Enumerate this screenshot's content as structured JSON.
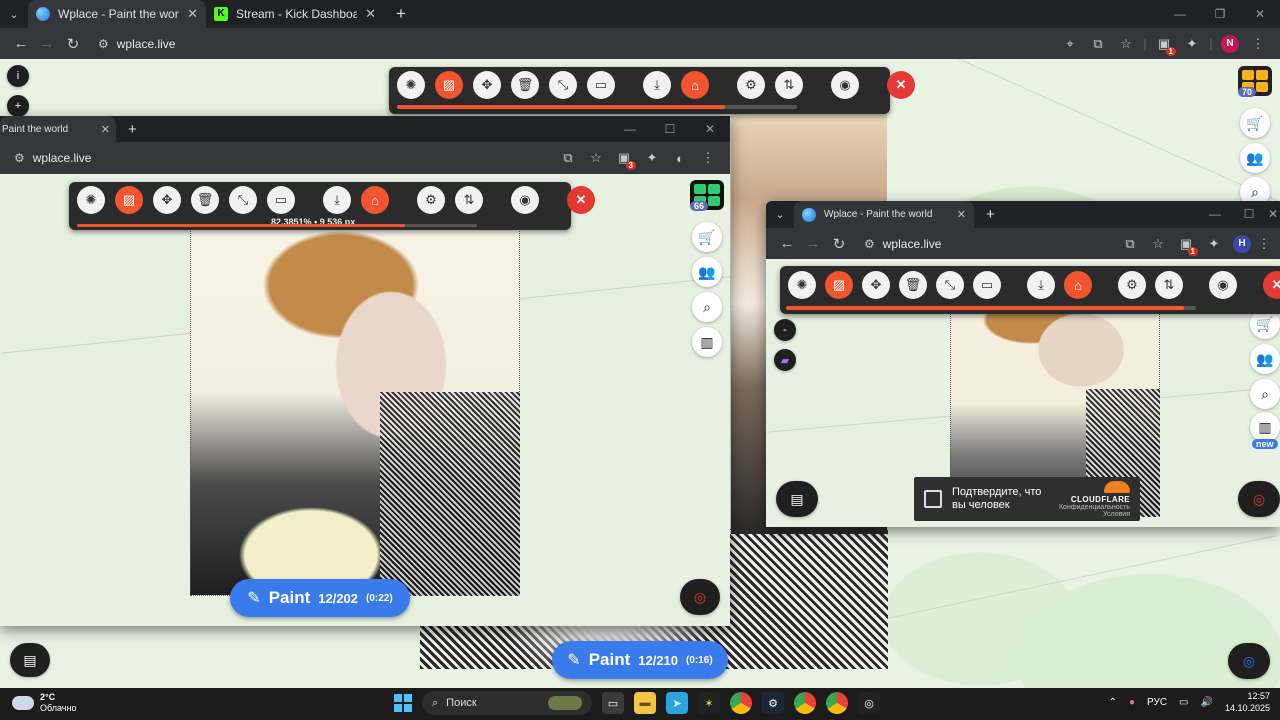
{
  "browser": {
    "tabs": [
      {
        "title": "Wplace - Paint the world",
        "active": true
      },
      {
        "title": "Stream - Kick Dashboard",
        "active": false
      }
    ],
    "url": "wplace.live",
    "profile_initial": "N",
    "ext_badge": "1"
  },
  "map_controls": {
    "info_label": "i",
    "zoom_in_label": "+",
    "level_badge": "70"
  },
  "bot_panel_main": {
    "progress_fraction": 0.82
  },
  "window_left": {
    "tab_title": "Paint the world",
    "url": "wplace.live",
    "ext_badge": "3",
    "bot_panel": {
      "stats_percent": "82.3851%",
      "stats_sep": "•",
      "stats_count": "9 536 px",
      "progress_fraction": 0.82
    },
    "level_badge": "66",
    "paint_button": {
      "label": "Paint",
      "count": "12/202",
      "timer": "(0:22)"
    }
  },
  "window_right": {
    "tab_title": "Wplace - Paint the world",
    "url": "wplace.live",
    "ext_badge": "1",
    "profile_initial": "H",
    "new_badge": "new",
    "zoom_out_label": "-",
    "captcha": {
      "text": "Подтвердите, что вы человек",
      "brand": "CLOUDFLARE",
      "links": "Конфиденциальность",
      "terms": "Условия"
    },
    "bot_panel": {
      "progress_fraction": 0.97
    }
  },
  "paint_button_bottom": {
    "label": "Paint",
    "count": "12/210",
    "timer": "(0:16)"
  },
  "taskbar": {
    "weather_temp": "2°C",
    "weather_desc": "Облачно",
    "search_placeholder": "Поиск",
    "lang": "РУС",
    "time": "12:57",
    "date": "14.10.2025"
  },
  "colors": {
    "accent": "#f0552f",
    "paint_blue": "#3a7bec",
    "close_red": "#e53935"
  }
}
